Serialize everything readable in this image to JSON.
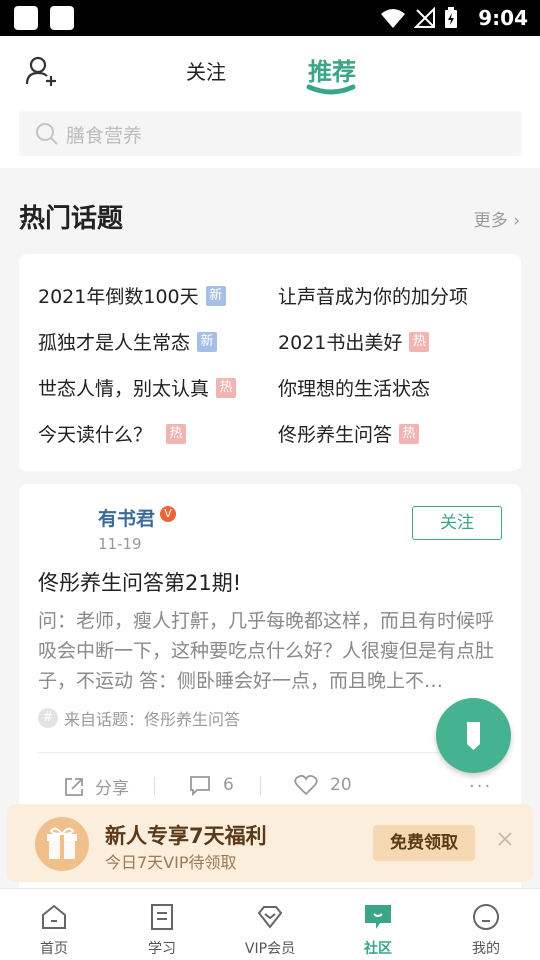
{
  "status_bar": {
    "time": "9:04"
  },
  "header": {
    "tabs": [
      {
        "label": "关注",
        "active": false
      },
      {
        "label": "推荐",
        "active": true
      }
    ],
    "search_placeholder": "膳食营养"
  },
  "hot_topics": {
    "title": "热门话题",
    "more_label": "更多",
    "items": [
      {
        "label": "2021年倒数100天",
        "badge": "新",
        "badge_type": "new"
      },
      {
        "label": "让声音成为你的加分项",
        "badge": "",
        "badge_type": ""
      },
      {
        "label": "孤独才是人生常态",
        "badge": "新",
        "badge_type": "new"
      },
      {
        "label": "2021书出美好",
        "badge": "热",
        "badge_type": "hot"
      },
      {
        "label": "世态人情，别太认真",
        "badge": "热",
        "badge_type": "hot"
      },
      {
        "label": "你理想的生活状态",
        "badge": "",
        "badge_type": ""
      },
      {
        "label": "今天读什么？",
        "badge": "热",
        "badge_type": "hot"
      },
      {
        "label": "佟彤养生问答",
        "badge": "热",
        "badge_type": "hot"
      }
    ]
  },
  "post": {
    "author": "有书君",
    "verified_badge": "V",
    "date": "11-19",
    "follow_label": "关注",
    "title": "佟彤养生问答第21期!",
    "body": "问：老师，瘦人打鼾，几乎每晚都这样，而且有时候呼吸会中断一下，这种要吃点什么好？人很瘦但是有点肚子，不运动 答：侧卧睡会好一点，而且晚上不…",
    "topic_source": "来自话题：佟彤养生问答",
    "share_label": "分享",
    "comment_count": "6",
    "like_count": "20"
  },
  "promo": {
    "title": "新人专享7天福利",
    "subtitle": "今日7天VIP待领取",
    "claim_label": "免费领取"
  },
  "bottom_nav": [
    {
      "label": "首页",
      "icon": "home-icon",
      "active": false
    },
    {
      "label": "学习",
      "icon": "study-icon",
      "active": false
    },
    {
      "label": "VIP会员",
      "icon": "vip-diamond-icon",
      "active": false
    },
    {
      "label": "社区",
      "icon": "community-icon",
      "active": true
    },
    {
      "label": "我的",
      "icon": "profile-icon",
      "active": false
    }
  ],
  "colors": {
    "accent": "#3aa687",
    "new_badge": "#a6bfe6",
    "hot_badge": "#f1b4b0",
    "promo_bg": "#fbeedc"
  }
}
